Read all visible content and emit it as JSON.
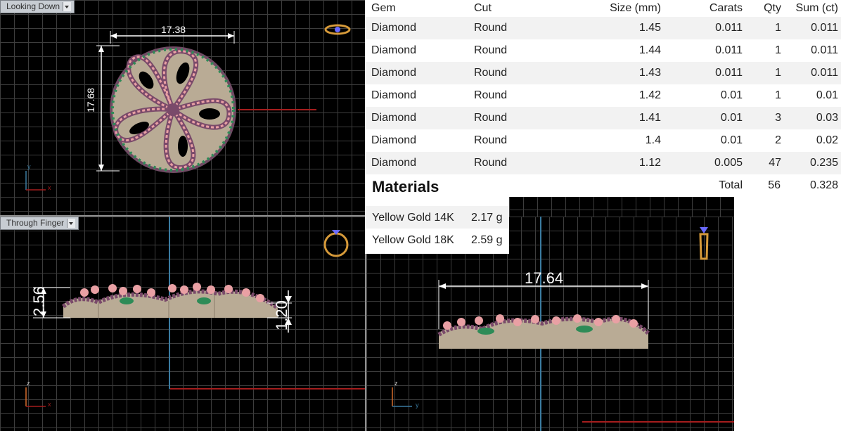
{
  "views": {
    "top": {
      "label": "Looking Down",
      "width_dim": "17.38",
      "height_dim": "17.68",
      "axis_x": "x",
      "axis_y": "y"
    },
    "front": {
      "label": "Through Finger",
      "height_dim_left": "2.56",
      "height_dim_right": "1.20",
      "axis_x": "x",
      "axis_z": "z"
    },
    "side": {
      "width_dim": "17.64",
      "axis_y": "y",
      "axis_z": "z"
    }
  },
  "gems": {
    "headers": {
      "gem": "Gem",
      "cut": "Cut",
      "size": "Size (mm)",
      "carats": "Carats",
      "qty": "Qty",
      "sum": "Sum (ct)"
    },
    "rows": [
      {
        "gem": "Diamond",
        "cut": "Round",
        "size": "1.45",
        "carats": "0.011",
        "qty": "1",
        "sum": "0.011"
      },
      {
        "gem": "Diamond",
        "cut": "Round",
        "size": "1.44",
        "carats": "0.011",
        "qty": "1",
        "sum": "0.011"
      },
      {
        "gem": "Diamond",
        "cut": "Round",
        "size": "1.43",
        "carats": "0.011",
        "qty": "1",
        "sum": "0.011"
      },
      {
        "gem": "Diamond",
        "cut": "Round",
        "size": "1.42",
        "carats": "0.01",
        "qty": "1",
        "sum": "0.01"
      },
      {
        "gem": "Diamond",
        "cut": "Round",
        "size": "1.41",
        "carats": "0.01",
        "qty": "3",
        "sum": "0.03"
      },
      {
        "gem": "Diamond",
        "cut": "Round",
        "size": "1.4",
        "carats": "0.01",
        "qty": "2",
        "sum": "0.02"
      },
      {
        "gem": "Diamond",
        "cut": "Round",
        "size": "1.12",
        "carats": "0.005",
        "qty": "47",
        "sum": "0.235"
      }
    ],
    "total_label": "Total",
    "total_qty": "56",
    "total_sum": "0.328"
  },
  "materials": {
    "title": "Materials",
    "items": [
      {
        "name": "Yellow Gold 14K",
        "weight": "2.17 g"
      },
      {
        "name": "Yellow Gold 18K",
        "weight": "2.59 g"
      }
    ]
  },
  "colors": {
    "grid": "#3d3d3d",
    "axis_blue": "#3a7ba0",
    "axis_red": "#a51d1d",
    "metal": "#b9ab95",
    "gem_pink": "#e9a0a4",
    "gem_green": "#2e8b57",
    "bead": "#7a4a6a"
  }
}
